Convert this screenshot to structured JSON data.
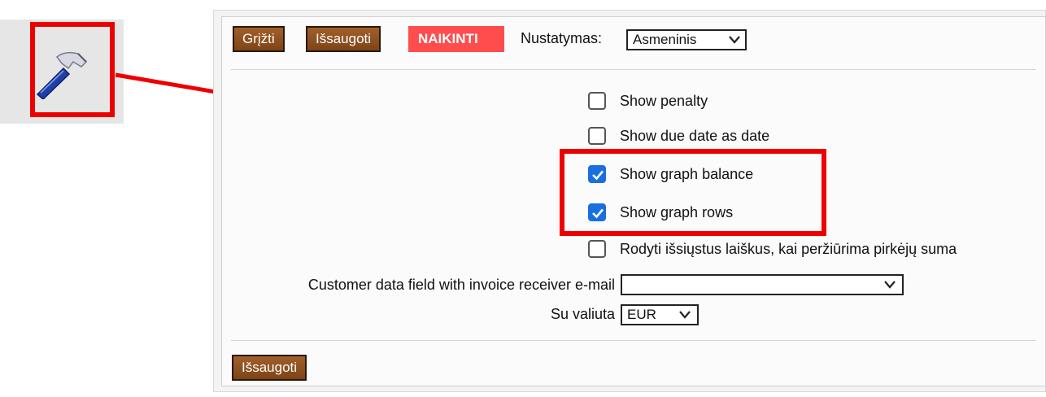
{
  "toolbar": {
    "back_label": "Grįžti",
    "save_label": "Išsaugoti",
    "delete_label": "NAIKINTI",
    "setting_label": "Nustatymas:",
    "setting_value": "Asmeninis"
  },
  "options": [
    {
      "label": "Show penalty",
      "checked": false
    },
    {
      "label": "Show due date as date",
      "checked": false
    },
    {
      "label": "Show graph balance",
      "checked": true
    },
    {
      "label": "Show graph rows",
      "checked": true
    },
    {
      "label": "Rodyti išsiųstus laiškus, kai peržiūrima pirkėjų suma",
      "checked": false
    }
  ],
  "fields": {
    "email_field_label": "Customer data field with invoice receiver e-mail",
    "email_field_value": "",
    "currency_label": "Su valiuta",
    "currency_value": "EUR"
  },
  "footer": {
    "save_label": "Išsaugoti"
  },
  "icons": {
    "tool": "hammer-icon",
    "dropdown": "chevron-down-icon",
    "check": "checkmark-icon"
  },
  "colors": {
    "button_brown": "#8b4d1f",
    "button_red": "#ff4d4d",
    "highlight_red": "#ee0000",
    "checkbox_blue": "#1a6fe0"
  }
}
